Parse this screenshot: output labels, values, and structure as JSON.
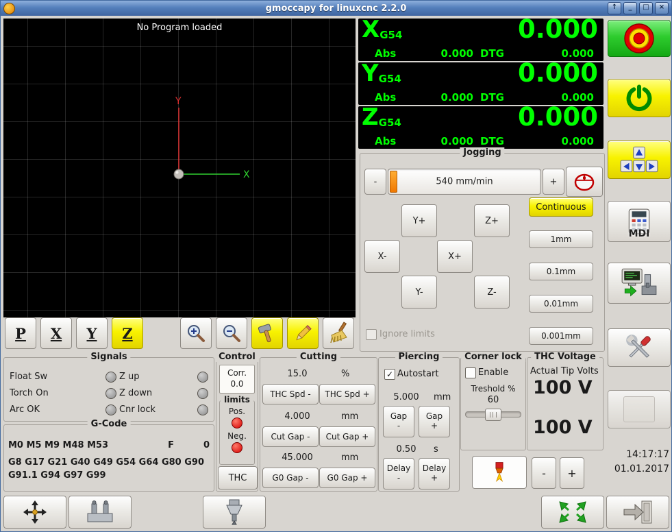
{
  "titlebar": {
    "title": "gmoccapy for linuxcnc  2.2.0",
    "buttons": {
      "roll": "↑",
      "min": "_",
      "max": "□",
      "close": "×"
    }
  },
  "icons": {
    "check": "✓"
  },
  "preview": {
    "message": "No Program loaded",
    "axis_x": "X",
    "axis_y": "Y",
    "toolbar": {
      "p": "P",
      "x": "X",
      "y": "Y",
      "z": "Z"
    }
  },
  "dro": {
    "axes": [
      {
        "letter": "X",
        "system": "G54",
        "value": "0.000",
        "abs_label": "Abs",
        "abs_value": "0.000",
        "dtg_label": "DTG",
        "dtg_value": "0.000"
      },
      {
        "letter": "Y",
        "system": "G54",
        "value": "0.000",
        "abs_label": "Abs",
        "abs_value": "0.000",
        "dtg_label": "DTG",
        "dtg_value": "0.000"
      },
      {
        "letter": "Z",
        "system": "G54",
        "value": "0.000",
        "abs_label": "Abs",
        "abs_value": "0.000",
        "dtg_label": "DTG",
        "dtg_value": "0.000"
      }
    ]
  },
  "jogging": {
    "title": "Jogging",
    "speed_minus": "-",
    "speed_plus": "+",
    "speed_value": "540 mm/min",
    "continuous": "Continuous",
    "jog": {
      "yp": "Y+",
      "zp": "Z+",
      "xm": "X-",
      "xp": "X+",
      "ym": "Y-",
      "zm": "Z-"
    },
    "increments": [
      "1mm",
      "0.1mm",
      "0.01mm",
      "0.001mm"
    ],
    "ignore_limits": "Ignore limits"
  },
  "signals": {
    "title": "Signals",
    "left": [
      "Float Sw",
      "Torch On",
      "Arc OK"
    ],
    "right": [
      "Z up",
      "Z down",
      "Cnr lock"
    ]
  },
  "gcode": {
    "title": "G-Code",
    "mcodes": "M0 M5 M9 M48 M53",
    "f_label": "F",
    "f_value": "0",
    "gcodes": "G8 G17 G21 G40 G49 G54 G64 G80 G90 G91.1 G94 G97 G99"
  },
  "control": {
    "title": "Control",
    "corr_label": "Corr.",
    "corr_value": "0.0",
    "limits_title": "limits",
    "pos_label": "Pos.",
    "neg_label": "Neg.",
    "thc_button": "THC"
  },
  "cutting": {
    "title": "Cutting",
    "rows": [
      {
        "value": "15.0",
        "unit": "%",
        "minus": "THC Spd -",
        "plus": "THC Spd +"
      },
      {
        "value": "4.000",
        "unit": "mm",
        "minus": "Cut Gap -",
        "plus": "Cut Gap +"
      },
      {
        "value": "45.000",
        "unit": "mm",
        "minus": "G0 Gap -",
        "plus": "G0 Gap +"
      }
    ]
  },
  "piercing": {
    "title": "Piercing",
    "autostart": "Autostart",
    "rows": [
      {
        "value": "5.000",
        "unit": "mm",
        "name": "Gap",
        "minus": "-",
        "plus": "+"
      },
      {
        "value": "0.50",
        "unit": "s",
        "name": "Delay",
        "minus": "-",
        "plus": "+"
      }
    ]
  },
  "corner_lock": {
    "title": "Corner lock",
    "enable": "Enable",
    "threshold_label": "Treshold %",
    "threshold_value": "60"
  },
  "thc_voltage": {
    "title": "THC Voltage",
    "subtitle": "Actual Tip Volts",
    "actual": "100 V",
    "setpoint": "100 V",
    "minus": "-",
    "plus": "+"
  },
  "right_panel": {
    "mdi_label": "MDI",
    "clock_time": "14:17:17",
    "clock_date": "01.01.2017"
  },
  "colors": {
    "dro_green": "#00ff00",
    "active_yellow": "#f8f200",
    "estop_red": "#e00000",
    "led_red": "#d40000",
    "titlebar_blue": "#5580bc"
  }
}
